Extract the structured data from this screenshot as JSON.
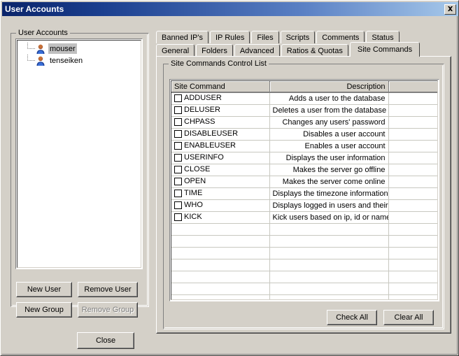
{
  "window": {
    "title": "User Accounts",
    "close_icon": "close-icon",
    "titlebar_gradient_start": "#0a246a",
    "titlebar_gradient_end": "#a6c8ea",
    "face_color": "#d4d0c8"
  },
  "left_panel": {
    "group_title": "User Accounts",
    "tree_items": [
      {
        "label": "mouser",
        "selected": true,
        "icon": "user-icon"
      },
      {
        "label": "tenseiken",
        "selected": false,
        "icon": "user-icon"
      }
    ],
    "buttons": [
      {
        "label": "New User",
        "enabled": true
      },
      {
        "label": "Remove User",
        "enabled": true
      },
      {
        "label": "New Group",
        "enabled": true
      },
      {
        "label": "Remove Group",
        "enabled": false
      }
    ],
    "close_button": "Close"
  },
  "tabs": {
    "row1": [
      {
        "label": "Banned IP's",
        "active": false
      },
      {
        "label": "IP Rules",
        "active": false
      },
      {
        "label": "Files",
        "active": false
      },
      {
        "label": "Scripts",
        "active": false
      },
      {
        "label": "Comments",
        "active": false
      },
      {
        "label": "Status",
        "active": false
      }
    ],
    "row2": [
      {
        "label": "General",
        "active": false
      },
      {
        "label": "Folders",
        "active": false
      },
      {
        "label": "Advanced",
        "active": false
      },
      {
        "label": "Ratios & Quotas",
        "active": false
      },
      {
        "label": "Site Commands",
        "active": true
      }
    ]
  },
  "site_commands": {
    "group_title": "Site Commands Control List",
    "columns": [
      "Site Command",
      "Description",
      ""
    ],
    "rows": [
      {
        "checked": false,
        "command": "ADDUSER",
        "description": "Adds a user to the database",
        "extra": ""
      },
      {
        "checked": false,
        "command": "DELUSER",
        "description": "Deletes a user from the database",
        "extra": ""
      },
      {
        "checked": false,
        "command": "CHPASS",
        "description": "Changes any users' password",
        "extra": ""
      },
      {
        "checked": false,
        "command": "DISABLEUSER",
        "description": "Disables a user account",
        "extra": ""
      },
      {
        "checked": false,
        "command": "ENABLEUSER",
        "description": "Enables a user account",
        "extra": ""
      },
      {
        "checked": false,
        "command": "USERINFO",
        "description": "Displays the user information",
        "extra": ""
      },
      {
        "checked": false,
        "command": "CLOSE",
        "description": "Makes the server go offline",
        "extra": ""
      },
      {
        "checked": false,
        "command": "OPEN",
        "description": "Makes the server come online",
        "extra": ""
      },
      {
        "checked": false,
        "command": "TIME",
        "description": "Displays the timezone information",
        "extra": ""
      },
      {
        "checked": false,
        "command": "WHO",
        "description": "Displays logged in users and their...",
        "extra": ""
      },
      {
        "checked": false,
        "command": "KICK",
        "description": "Kick users based on ip, id or name",
        "extra": ""
      }
    ],
    "empty_row_count": 7,
    "buttons": {
      "check_all": "Check All",
      "clear_all": "Clear All"
    }
  }
}
